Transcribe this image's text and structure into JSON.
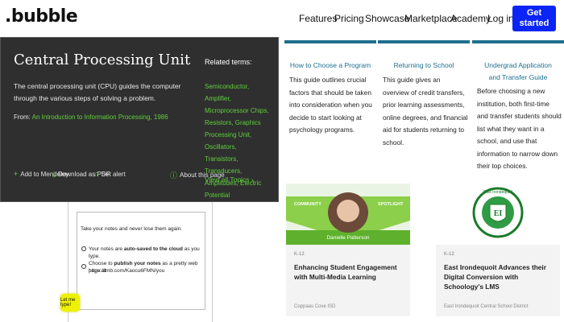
{
  "nav": {
    "logo": ".bubble",
    "links": [
      "Features",
      "Pricing",
      "Showcase",
      "Marketplace",
      "Academy"
    ],
    "login": "Log in",
    "cta": "Get started"
  },
  "popup": {
    "title": "Central Processing Unit",
    "description": "The central processing unit (CPU) guides the computer through the various steps of solving a problem.",
    "from_label": "From:",
    "from_link": "An Introduction to Information Processing, 1986",
    "related_heading": "Related terms:",
    "related_terms": "Semiconductor, Amplifier, Microprocessor Chips, Resistors, Graphics Processing Unit, Oscillators, Transistors, Transducers, Amplitudes, Electric Potential",
    "view_all": "View all Topics",
    "actions": {
      "mendeley": "Add to Mendeley",
      "pdf": "Download as PDF",
      "alert": "Set alert",
      "about": "About this page"
    }
  },
  "notes": {
    "line1": "Take your notes and never lose them again.",
    "line2_pre": "Your notes are ",
    "line2_bold": "auto-saved to the cloud",
    "line2_post": " as you type.",
    "line3_pre": "Choose to ",
    "line3_bold": "publish your notes",
    "line3_post": " as a pretty web page at",
    "line4": "https://lmb.com/Kaocu6FMN/you",
    "button": "Let me type!"
  },
  "guides": [
    {
      "title": "How to Choose a Program",
      "body": "This guide outlines crucial factors that should be taken into consideration when you decide to start looking at psychology programs."
    },
    {
      "title": "Returning to School",
      "body": "This guide gives an overview of credit transfers, prior learning assessments, online degrees, and financial aid for students returning to school."
    },
    {
      "title": "Undergrad Application and Transfer Guide",
      "body": "Before choosing a new institution, both first-time and transfer students should list what they want in a school, and use that information to narrow down their top choices."
    }
  ],
  "stories": [
    {
      "banner_left": "COMMUNITY",
      "banner_right": "SPOTLIGHT",
      "person": "Danielle Patterson",
      "tag": "K-12",
      "title": "Enhancing Student Engagement with Multi-Media Learning",
      "footer": "Coppaas Cove ISD"
    },
    {
      "tag": "K-12",
      "title": "East Irondequoit Advances their Digital Conversion with Schoology's LMS",
      "footer": "East Irondequoit Central School District",
      "seal_text": "East Irondequoit"
    }
  ]
}
